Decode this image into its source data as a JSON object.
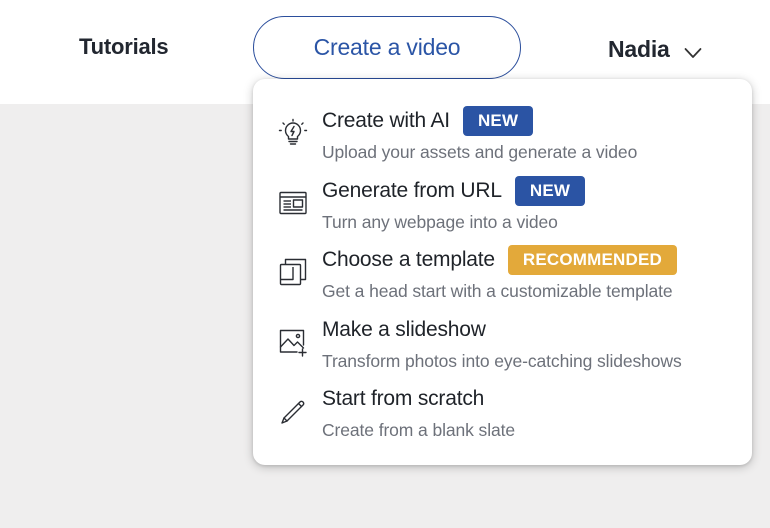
{
  "header": {
    "tutorials_label": "Tutorials",
    "create_button_label": "Create a video",
    "user_name": "Nadia"
  },
  "colors": {
    "accent_blue": "#2b55a6",
    "badge_new": "#2b54a4",
    "badge_recommended": "#e3a93a",
    "background": "#efeeee"
  },
  "dropdown": {
    "items": [
      {
        "title": "Create with AI",
        "badge": "NEW",
        "badge_color": "#2b54a4",
        "description": "Upload your assets and generate a video",
        "icon": "lightbulb-ai-icon"
      },
      {
        "title": "Generate from URL",
        "badge": "NEW",
        "badge_color": "#2b54a4",
        "description": "Turn any webpage into a video",
        "icon": "webpage-icon"
      },
      {
        "title": "Choose a template",
        "badge": "RECOMMENDED",
        "badge_color": "#e3a93a",
        "description": "Get a head start with a customizable template",
        "icon": "template-icon"
      },
      {
        "title": "Make a slideshow",
        "badge": "",
        "badge_color": "",
        "description": "Transform photos into eye-catching slideshows",
        "icon": "image-plus-icon"
      },
      {
        "title": "Start from scratch",
        "badge": "",
        "badge_color": "",
        "description": "Create from a blank slate",
        "icon": "pen-icon"
      }
    ]
  }
}
